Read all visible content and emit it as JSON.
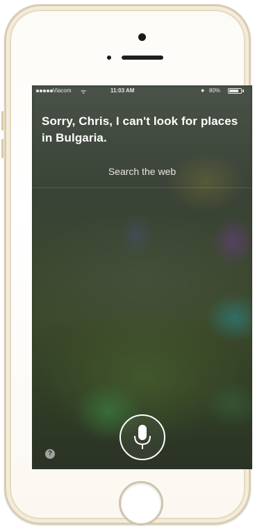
{
  "status_bar": {
    "carrier": "Viacom",
    "wifi_icon": "wifi-icon",
    "time": "11:03 AM",
    "battery_percent": "80%",
    "battery_level": 0.8
  },
  "siri": {
    "response": "Sorry, Chris, I can't look for places in Bulgaria.",
    "search_web_label": "Search the web",
    "help_label": "?"
  },
  "icons": {
    "mic": "microphone-icon",
    "help": "help-icon",
    "home": "home-button"
  },
  "colors": {
    "phone_trim": "#d9ccb0",
    "text": "#ffffff"
  }
}
